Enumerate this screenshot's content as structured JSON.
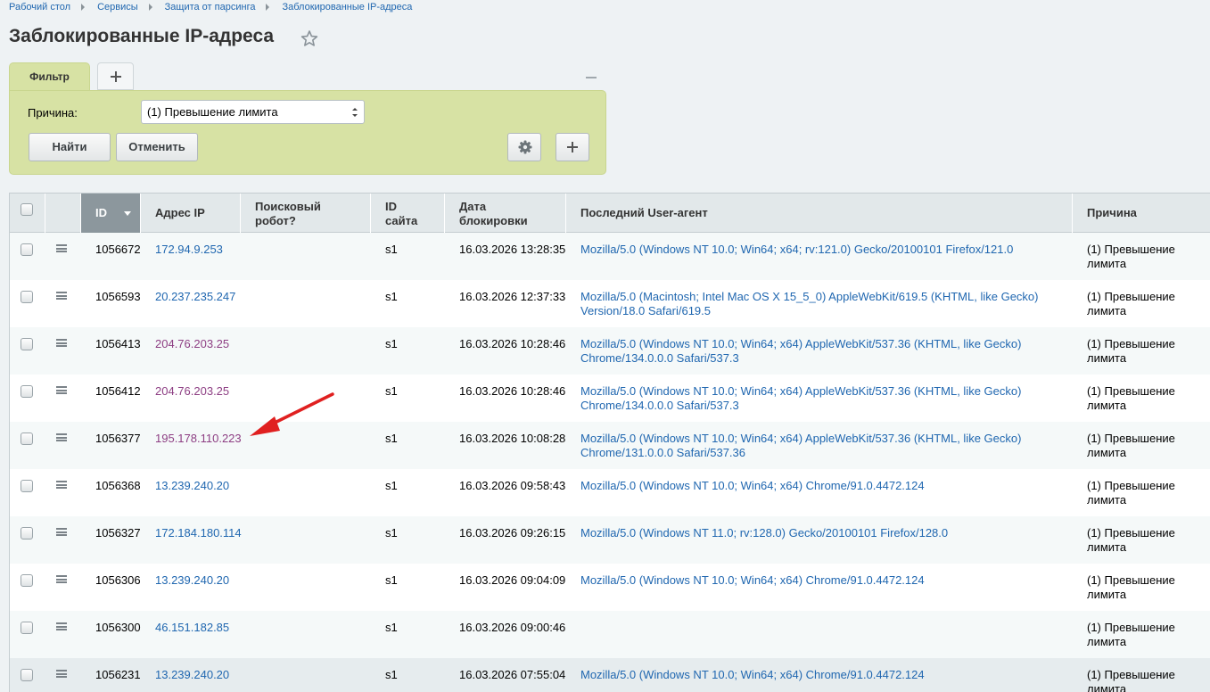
{
  "breadcrumb": [
    "Рабочий стол",
    "Сервисы",
    "Защита от парсинга",
    "Заблокированные IP-адреса"
  ],
  "page_title": "Заблокированные IP-адреса",
  "filter": {
    "tab_label": "Фильтр",
    "reason_label": "Причина:",
    "reason_value": "(1) Превышение лимита",
    "find_button": "Найти",
    "cancel_button": "Отменить"
  },
  "columns": {
    "id": "ID",
    "ip": "Адрес IP",
    "robot_line1": "Поисковый",
    "robot_line2": "робот?",
    "site_line1": "ID",
    "site_line2": "сайта",
    "date_line1": "Дата",
    "date_line2": "блокировки",
    "ua": "Последний User-агент",
    "reason": "Причина"
  },
  "rows": [
    {
      "id": "1056672",
      "ip": "172.94.9.253",
      "ip_visited": false,
      "site": "s1",
      "date": "16.03.2026 13:28:35",
      "ua": "Mozilla/5.0 (Windows NT 10.0; Win64; x64; rv:121.0) Gecko/20100101 Firefox/121.0",
      "reason_line1": "(1) Превышение",
      "reason_line2": "лимита"
    },
    {
      "id": "1056593",
      "ip": "20.237.235.247",
      "ip_visited": false,
      "site": "s1",
      "date": "16.03.2026 12:37:33",
      "ua": "Mozilla/5.0 (Macintosh; Intel Mac OS X 15_5_0) AppleWebKit/619.5 (KHTML, like Gecko) Version/18.0 Safari/619.5",
      "reason_line1": "(1) Превышение",
      "reason_line2": "лимита"
    },
    {
      "id": "1056413",
      "ip": "204.76.203.25",
      "ip_visited": true,
      "site": "s1",
      "date": "16.03.2026 10:28:46",
      "ua": "Mozilla/5.0 (Windows NT 10.0; Win64; x64) AppleWebKit/537.36 (KHTML, like Gecko) Chrome/134.0.0.0 Safari/537.3",
      "reason_line1": "(1) Превышение",
      "reason_line2": "лимита"
    },
    {
      "id": "1056412",
      "ip": "204.76.203.25",
      "ip_visited": true,
      "site": "s1",
      "date": "16.03.2026 10:28:46",
      "ua": "Mozilla/5.0 (Windows NT 10.0; Win64; x64) AppleWebKit/537.36 (KHTML, like Gecko) Chrome/134.0.0.0 Safari/537.3",
      "reason_line1": "(1) Превышение",
      "reason_line2": "лимита"
    },
    {
      "id": "1056377",
      "ip": "195.178.110.223",
      "ip_visited": true,
      "site": "s1",
      "date": "16.03.2026 10:08:28",
      "ua": "Mozilla/5.0 (Windows NT 10.0; Win64; x64) AppleWebKit/537.36 (KHTML, like Gecko) Chrome/131.0.0.0 Safari/537.36",
      "reason_line1": "(1) Превышение",
      "reason_line2": "лимита"
    },
    {
      "id": "1056368",
      "ip": "13.239.240.20",
      "ip_visited": false,
      "site": "s1",
      "date": "16.03.2026 09:58:43",
      "ua": "Mozilla/5.0 (Windows NT 10.0; Win64; x64) Chrome/91.0.4472.124",
      "reason_line1": "(1) Превышение",
      "reason_line2": "лимита"
    },
    {
      "id": "1056327",
      "ip": "172.184.180.114",
      "ip_visited": false,
      "site": "s1",
      "date": "16.03.2026 09:26:15",
      "ua": "Mozilla/5.0 (Windows NT 11.0; rv:128.0) Gecko/20100101 Firefox/128.0",
      "reason_line1": "(1) Превышение",
      "reason_line2": "лимита"
    },
    {
      "id": "1056306",
      "ip": "13.239.240.20",
      "ip_visited": false,
      "site": "s1",
      "date": "16.03.2026 09:04:09",
      "ua": "Mozilla/5.0 (Windows NT 10.0; Win64; x64) Chrome/91.0.4472.124",
      "reason_line1": "(1) Превышение",
      "reason_line2": "лимита"
    },
    {
      "id": "1056300",
      "ip": "46.151.182.85",
      "ip_visited": false,
      "site": "s1",
      "date": "16.03.2026 09:00:46",
      "ua": "",
      "reason_line1": "(1) Превышение",
      "reason_line2": "лимита"
    },
    {
      "id": "1056231",
      "ip": "13.239.240.20",
      "ip_visited": false,
      "site": "s1",
      "date": "16.03.2026 07:55:04",
      "ua": "Mozilla/5.0 (Windows NT 10.0; Win64; x64) Chrome/91.0.4472.124",
      "reason_line1": "(1) Превышение",
      "reason_line2": "лимита"
    }
  ],
  "annotation": {
    "arrow_color": "#e02020"
  }
}
